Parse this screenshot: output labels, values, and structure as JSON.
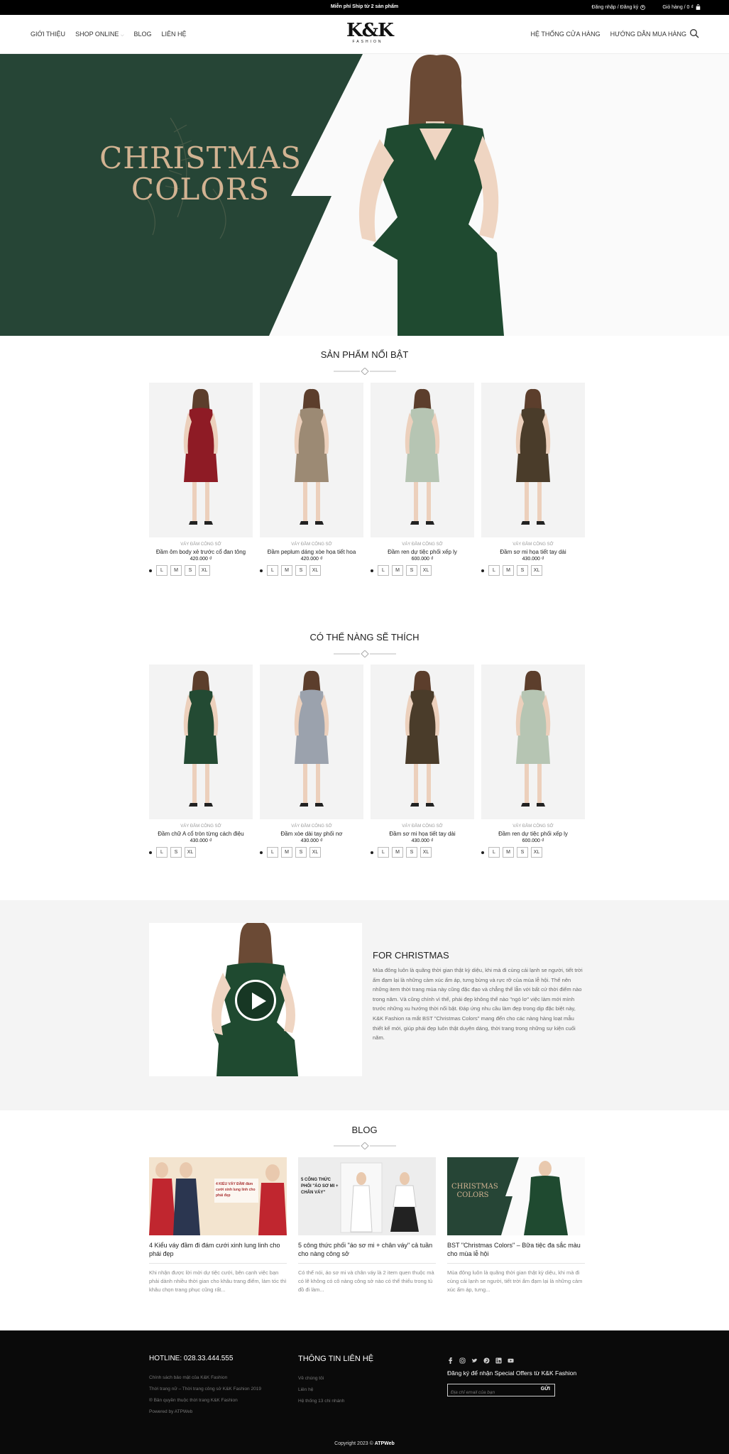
{
  "topbar": {
    "promo": "Miễn phí Ship từ 2 sản phẩm",
    "account": "Đăng nhập / Đăng ký",
    "cart": "Giỏ hàng / 0 ₫"
  },
  "nav": {
    "left": [
      "GIỚI THIỆU",
      "SHOP ONLINE",
      "BLOG",
      "LIÊN HỆ"
    ],
    "right": [
      "HỆ THỐNG CỬA HÀNG",
      "HƯỚNG DẪN MUA HÀNG"
    ]
  },
  "logo": {
    "mark": "K&K",
    "sub": "FASHION"
  },
  "hero": {
    "line1": "CHRISTMAS",
    "line2": "COLORS"
  },
  "featured": {
    "title": "SẢN PHẨM NỔI BẬT",
    "products": [
      {
        "category": "VÁY ĐẦM CÔNG SỞ",
        "name": "Đầm ôm body xẻ trước cổ đan tông",
        "price": "420.000 ₫",
        "sizes": [
          "L",
          "M",
          "S",
          "XL"
        ],
        "color": "#8e1b25"
      },
      {
        "category": "VÁY ĐẦM CÔNG SỞ",
        "name": "Đầm peplum dáng xòe họa tiết hoa",
        "price": "420.000 ₫",
        "sizes": [
          "L",
          "M",
          "S",
          "XL"
        ],
        "color": "#9c8a74"
      },
      {
        "category": "VÁY ĐẦM CÔNG SỞ",
        "name": "Đầm ren dự tiệc phối xếp ly",
        "price": "600.000 ₫",
        "sizes": [
          "L",
          "M",
          "S",
          "XL"
        ],
        "color": "#b6c5b3"
      },
      {
        "category": "VÁY ĐẦM CÔNG SỞ",
        "name": "Đầm sơ mi họa tiết tay dài",
        "price": "430.000 ₫",
        "sizes": [
          "L",
          "M",
          "S",
          "XL"
        ],
        "color": "#4a3c2a"
      }
    ]
  },
  "liked": {
    "title": "CÓ THỂ NÀNG SẼ THÍCH",
    "products": [
      {
        "category": "VÁY ĐẦM CÔNG SỞ",
        "name": "Đầm chữ A cổ tròn từng cách điệu",
        "price": "430.000 ₫",
        "sizes": [
          "L",
          "S",
          "XL"
        ],
        "color": "#234a33"
      },
      {
        "category": "VÁY ĐẦM CÔNG SỞ",
        "name": "Đầm xòe dài tay phối nơ",
        "price": "430.000 ₫",
        "sizes": [
          "L",
          "M",
          "S",
          "XL"
        ],
        "color": "#9ba2ad"
      },
      {
        "category": "VÁY ĐẦM CÔNG SỞ",
        "name": "Đầm sơ mi họa tiết tay dài",
        "price": "430.000 ₫",
        "sizes": [
          "L",
          "M",
          "S",
          "XL"
        ],
        "color": "#4a3c2a"
      },
      {
        "category": "VÁY ĐẦM CÔNG SỞ",
        "name": "Đầm ren dự tiệc phối xếp ly",
        "price": "600.000 ₫",
        "sizes": [
          "L",
          "M",
          "S",
          "XL"
        ],
        "color": "#b6c5b3"
      }
    ]
  },
  "christmas": {
    "title": "FOR CHRISTMAS",
    "text": "Mùa đông luôn là quãng thời gian thật kỳ diệu, khi mà đi cùng cái lạnh se người, tiết trời ẩm đạm lại là những cảm xúc ấm áp, tưng bừng và rực rỡ của mùa lễ hội. Thế nên những item thời trang mùa này cũng đặc đạo và chẳng thể lẫn với bất cứ thời điểm nào trong năm. Và cũng chính vì thế, phái đẹp không thể nào \"ngó lơ\" việc làm mới mình trước những xu hướng thời nổi bật. Đáp ứng nhu cầu làm đẹp trong dịp đặc biệt này, K&K Fashion ra mắt BST \"Christmas Colors\" mang đến cho các nàng hàng loạt mẫu thiết kế mới, giúp phái đẹp luôn thật duyên dáng, thời trang trong những sự kiện cuối năm."
  },
  "blog": {
    "title": "BLOG",
    "posts": [
      {
        "title": "4 Kiểu váy đầm đi đám cưới xinh lung linh cho phái đẹp",
        "excerpt": "Khi nhận được lời mời dự tiệc cưới, bên cạnh việc bạn phải dành nhiều thời gian cho khâu trang điểm, làm tóc thì khâu chọn trang phục cũng rất...",
        "banner": "4 KIỂU VÁY ĐẦM đám cưới xinh lung linh cho phái đẹp"
      },
      {
        "title": "5 công thức phối \"áo sơ mi + chân váy\" cả tuần cho nàng công sở",
        "excerpt": "Có thể nói, áo sơ mi và chân váy là 2 item quen thuộc mà có lẽ không có cô nàng công sở nào có thể thiếu trong tủ đồ đi làm...",
        "banner": "5 CÔNG THỨC PHỐI \"ÁO SƠ MI + CHÂN VÁY\""
      },
      {
        "title": "BST \"Christmas Colors\" – Bữa tiệc đa sắc màu cho mùa lễ hội",
        "excerpt": "Mùa đông luôn là quãng thời gian thật kỳ diệu, khi mà đi cùng cái lạnh se người, tiết trời ẩm đạm lại là những cảm xúc ấm áp, tưng...",
        "banner": "CHRISTMAS COLORS"
      }
    ]
  },
  "footer": {
    "hotline_label": "HOTLINE:",
    "hotline": "028.33.444.555",
    "links1": [
      "Chính sách bảo mật của K&K Fashion",
      "Thời trang nữ – Thời trang công sở K&K Fashion 2019",
      "® Bản quyền thuộc thời trang K&K Fashion",
      "Powered by ATPWeb"
    ],
    "contact_title": "THÔNG TIN LIÊN HỆ",
    "links2": [
      "Về chúng tôi",
      "Liên hệ",
      "Hệ thống 13 chi nhánh"
    ],
    "subscribe": "Đăng ký để nhận Special Offers từ K&K Fashion",
    "email_placeholder": "Địa chỉ email của bạn",
    "submit": "GỬI",
    "copyright_prefix": "Copyright 2023 ©",
    "copyright_brand": "ATPWeb"
  },
  "colors": {
    "hero_green": "#264536",
    "gold": "#d2b392",
    "footer_bg": "#0a0a0a"
  }
}
